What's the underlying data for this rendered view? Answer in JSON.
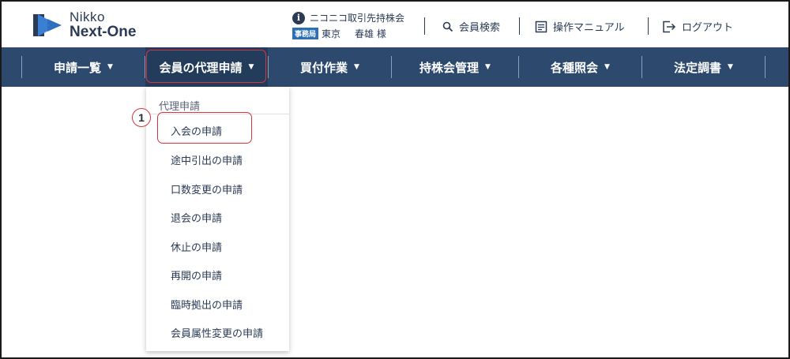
{
  "logo": {
    "line1": "Nikko",
    "line2": "Next-One"
  },
  "company": {
    "name": "ニコニコ取引先持株会",
    "office_badge": "事務局",
    "office": "東京",
    "user": "春雄 様"
  },
  "header_actions": {
    "member_search": "会員検索",
    "manual": "操作マニュアル",
    "logout": "ログアウト"
  },
  "nav": {
    "items": [
      {
        "label": "申請一覧",
        "caret": "▼"
      },
      {
        "label": "会員の代理申請",
        "caret": "▼"
      },
      {
        "label": "買付作業",
        "caret": "▼"
      },
      {
        "label": "持株会管理",
        "caret": "▼"
      },
      {
        "label": "各種照会",
        "caret": "▼"
      },
      {
        "label": "法定調書",
        "caret": "▼"
      }
    ],
    "active_index": 1
  },
  "dropdown": {
    "header": "代理申請",
    "items": [
      "入会の申請",
      "途中引出の申請",
      "口数変更の申請",
      "退会の申請",
      "休止の申請",
      "再開の申請",
      "臨時拠出の申請",
      "会員属性変更の申請"
    ]
  },
  "annotation": {
    "step_number": "1"
  },
  "colors": {
    "nav_bg": "#2d4a6e",
    "highlight": "#d9343b",
    "text": "#2b3a55",
    "badge_blue": "#2d6fb7"
  }
}
